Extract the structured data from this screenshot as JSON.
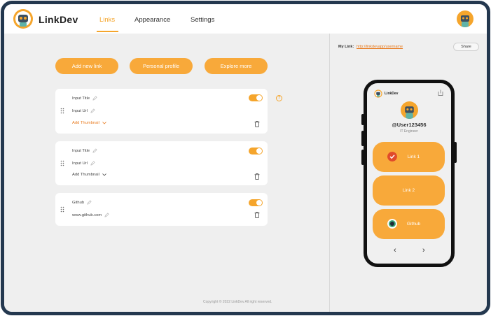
{
  "app": {
    "name": "LinkDev"
  },
  "nav": {
    "tabs": [
      {
        "label": "Links",
        "active": true
      },
      {
        "label": "Appearance",
        "active": false
      },
      {
        "label": "Settings",
        "active": false
      }
    ]
  },
  "actions": {
    "add_new_link": "Add new link",
    "personal_profile": "Personal profile",
    "explore_more": "Explore more"
  },
  "links": [
    {
      "title": "Input Title",
      "url": "Input Url",
      "thumbnail_label": "Add Thumbnail",
      "thumbnail_active": true,
      "enabled": true
    },
    {
      "title": "Input Title",
      "url": "Input Url",
      "thumbnail_label": "Add Thumbnail",
      "thumbnail_active": false,
      "enabled": true
    },
    {
      "title": "Github",
      "url": "www.github.com",
      "enabled": true
    }
  ],
  "help": {
    "icon": "question-icon",
    "glyph": "?"
  },
  "footer": {
    "copyright": "Copyright © 2022 LinkDev All right reserved."
  },
  "preview": {
    "my_link_label": "My Link:",
    "my_link_url": "http://linkdevapp/username",
    "share_label": "Share",
    "phone": {
      "brand": "LinkDev",
      "username": "@User123456",
      "role": "IT Engineer",
      "buttons": [
        {
          "label": "Link 1",
          "icon": "check-icon"
        },
        {
          "label": "Link 2",
          "icon": null
        },
        {
          "label": "Github",
          "icon": "github-icon"
        }
      ],
      "prev_glyph": "‹",
      "next_glyph": "›"
    }
  },
  "colors": {
    "accent": "#f5a52c",
    "button": "#f8a93a",
    "frame": "#24384f",
    "link": "#e87a1d"
  }
}
